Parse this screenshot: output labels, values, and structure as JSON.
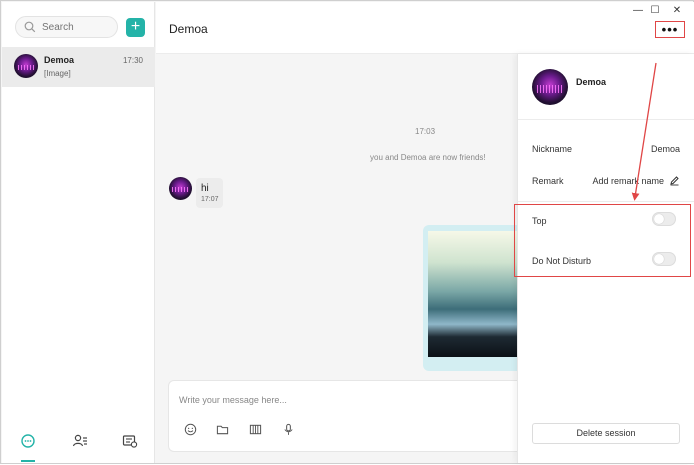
{
  "window": {
    "minimize": "—",
    "maximize": "☐",
    "close": "✕"
  },
  "sidebar": {
    "search_placeholder": "Search",
    "add_label": "+",
    "sessions": [
      {
        "name": "Demoa",
        "time": "17:30",
        "preview": "[Image]"
      }
    ],
    "nav": [
      "chat-icon",
      "contacts-icon",
      "groups-icon"
    ]
  },
  "chat": {
    "title": "Demoa",
    "more_label": "•••",
    "timestamp": "17:03",
    "system_message": "you and Demoa are now friends!",
    "messages": [
      {
        "text": "hi",
        "time": "17:07"
      }
    ],
    "composer_placeholder": "Write your message here...",
    "tools": [
      "emoji-icon",
      "folder-icon",
      "screenshot-icon",
      "microphone-icon"
    ]
  },
  "panel": {
    "name": "Demoa",
    "nickname_label": "Nickname",
    "nickname_value": "Demoa",
    "remark_label": "Remark",
    "remark_value": "Add remark name",
    "top_label": "Top",
    "top_on": false,
    "dnd_label": "Do Not Disturb",
    "dnd_on": false,
    "delete_label": "Delete session"
  },
  "colors": {
    "accent": "#24b3a8",
    "annotation": "#e04646"
  }
}
